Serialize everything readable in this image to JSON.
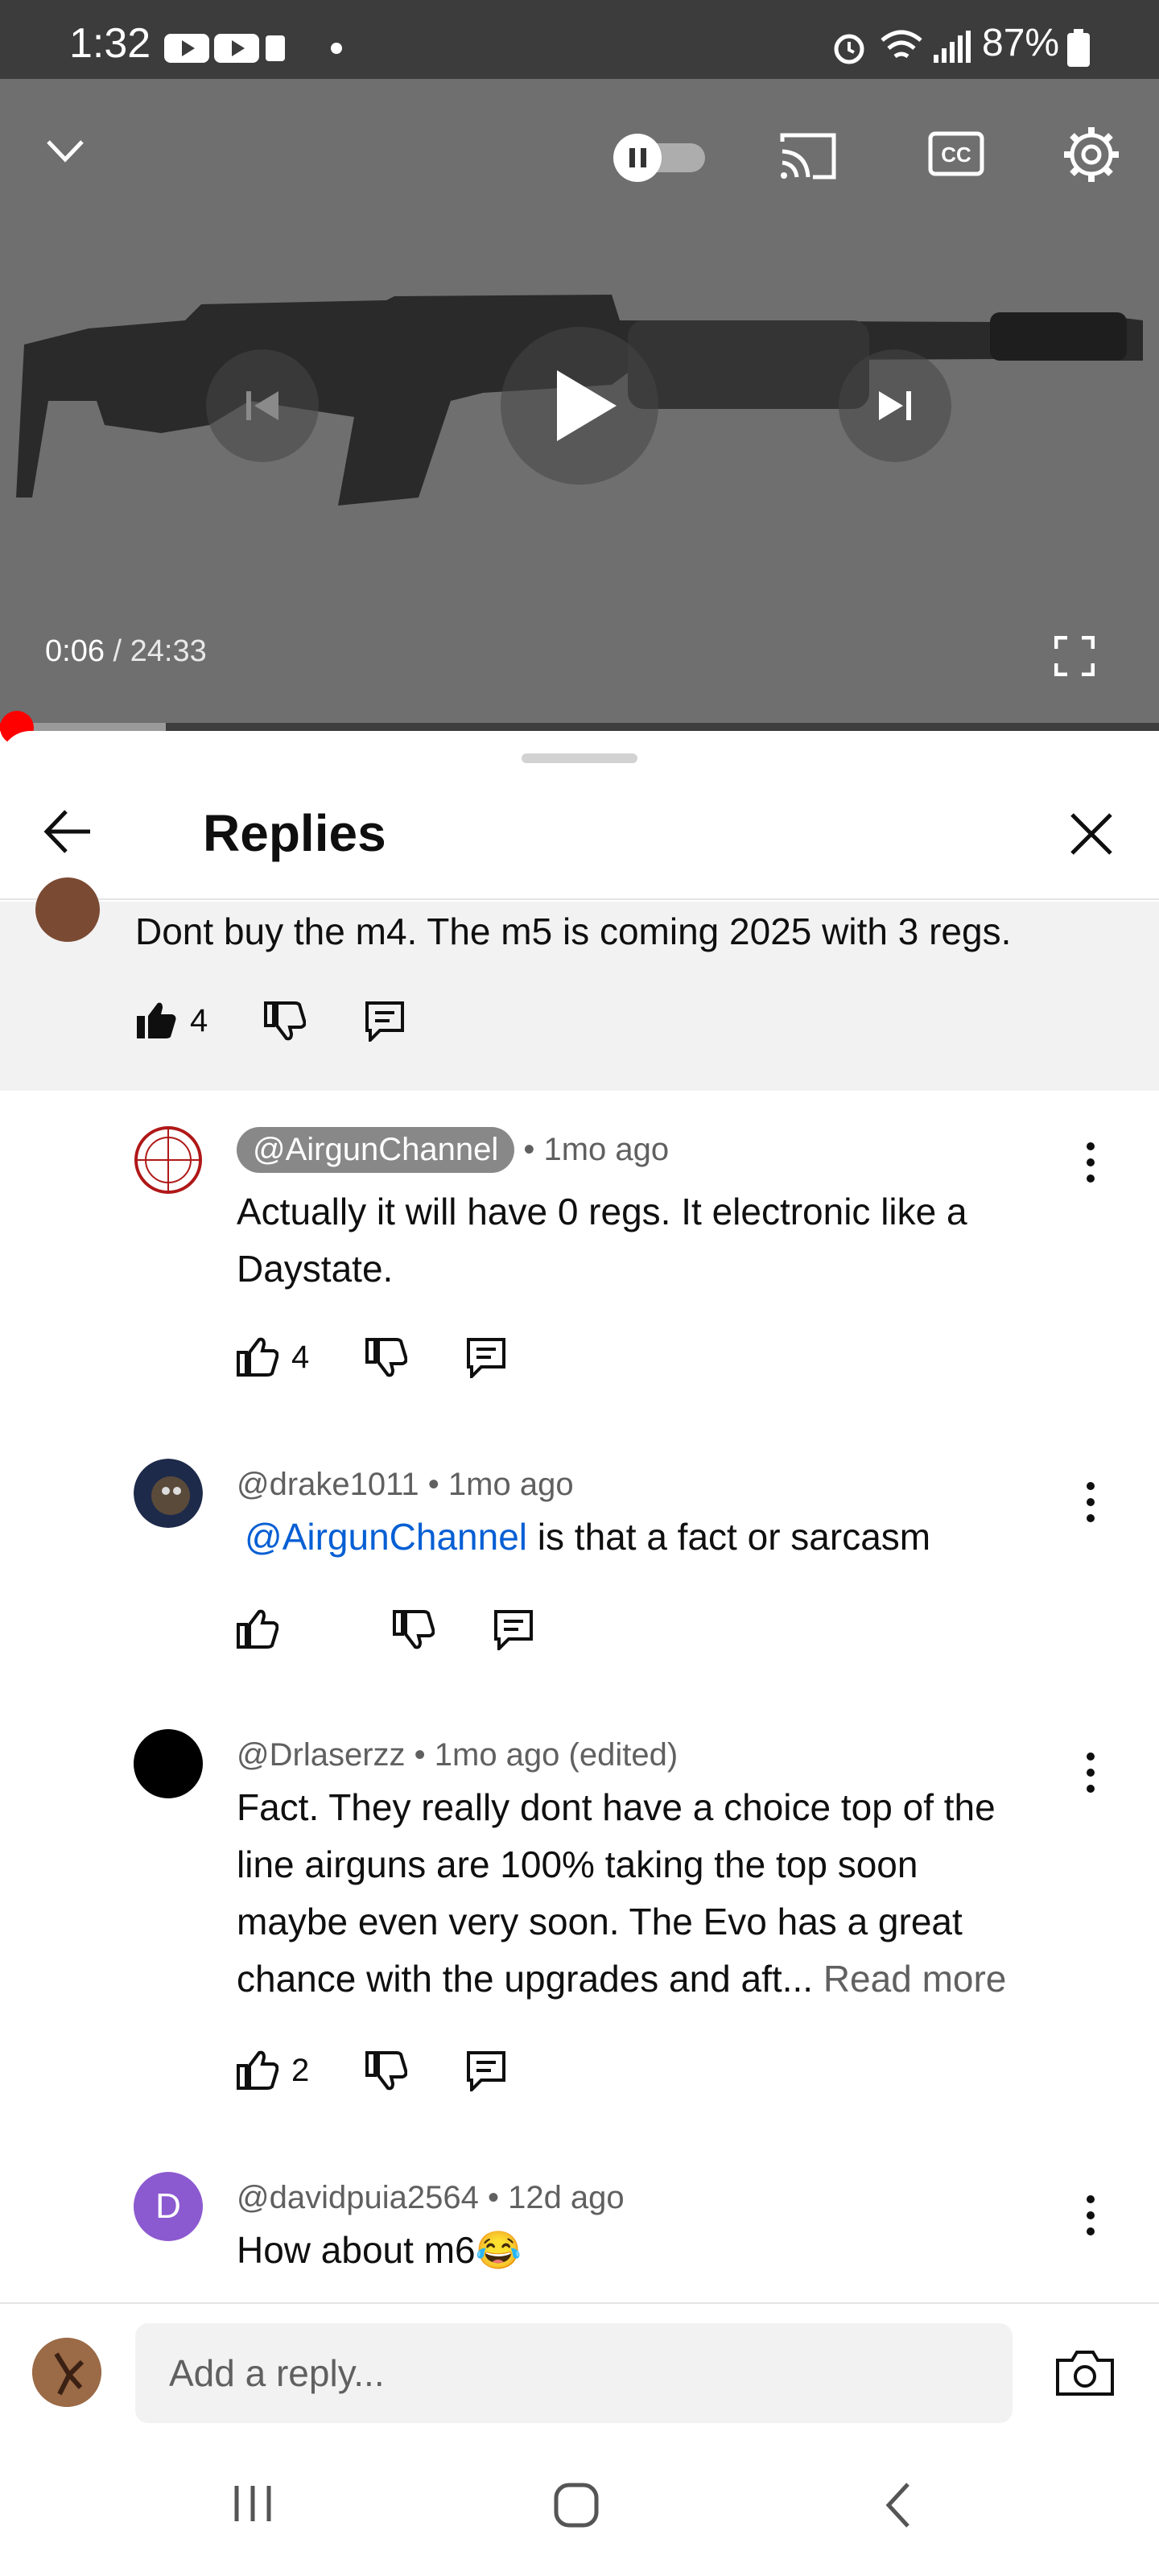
{
  "status_bar": {
    "time": "1:32",
    "battery": "87%"
  },
  "video": {
    "current_time": "0:06",
    "separator": " / ",
    "duration": "24:33",
    "progress_fraction": 0.004,
    "buffered_fraction": 0.06,
    "controls": [
      "chevron-down-icon",
      "autoplay-toggle",
      "cast-icon",
      "captions-icon",
      "settings-icon",
      "previous-icon",
      "play-icon",
      "next-icon",
      "fullscreen-icon"
    ]
  },
  "sheet": {
    "title": "Replies"
  },
  "parent_comment": {
    "text": "Dont buy the m4. The m5 is coming 2025 with 3 regs.",
    "likes": "4"
  },
  "replies": [
    {
      "handle": "@AirgunChannel",
      "is_creator": true,
      "meta": " • 1mo ago",
      "lines": [
        "Actually it will have 0 regs. It electronic like a",
        "Daystate."
      ],
      "likes": "4"
    },
    {
      "handle": "@drake1011",
      "meta": " • 1mo ago",
      "mention": "@AirgunChannel",
      "text": " is that a fact or sarcasm",
      "likes": ""
    },
    {
      "handle": "@Drlaserzz",
      "meta": " • 1mo ago (edited)",
      "lines": [
        "Fact. They really dont have a choice top of the",
        "line airguns are 100% taking the top soon",
        "maybe even very soon. The Evo has a great",
        "chance with the upgrades and aft..."
      ],
      "read_more": "Read more",
      "likes": "2"
    },
    {
      "handle": "@davidpuia2564",
      "meta": " • 12d ago",
      "avatar_letter": "D",
      "text": "How about m6",
      "emoji": "😂"
    }
  ],
  "composer": {
    "placeholder": "Add a reply..."
  },
  "colors": {
    "accent_red": "#ff0000",
    "link_blue": "#065fd4",
    "avatar_purple": "#8c5ad0"
  }
}
